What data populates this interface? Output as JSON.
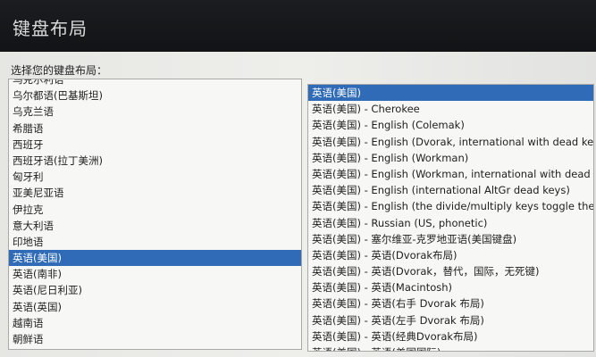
{
  "window": {
    "title": "键盘布局"
  },
  "prompt": "选择您的键盘布局：",
  "left_list": {
    "items": [
      "乌克尔利语",
      "乌尔都语(巴基斯坦)",
      "乌克兰语",
      "希腊语",
      "西班牙",
      "西班牙语(拉丁美洲)",
      "匈牙利",
      "亚美尼亚语",
      "伊拉克",
      "意大利语",
      "印地语",
      "英语(美国)",
      "英语(南非)",
      "英语(尼日利亚)",
      "英语(英国)",
      "越南语",
      "朝鲜语"
    ],
    "selected_index": 11
  },
  "right_list": {
    "items": [
      "英语(美国)",
      "英语(美国) - Cherokee",
      "英语(美国) - English (Colemak)",
      "英语(美国) - English (Dvorak, international with dead keys)",
      "英语(美国) - English (Workman)",
      "英语(美国) - English (Workman, international with dead keys)",
      "英语(美国) - English (international AltGr dead keys)",
      "英语(美国) - English (the divide/multiply keys toggle the layout)",
      "英语(美国) - Russian (US, phonetic)",
      "英语(美国) - 塞尔维亚-克罗地亚语(美国键盘)",
      "英语(美国) - 英语(Dvorak布局)",
      "英语(美国) - 英语(Dvorak，替代，国际，无死键)",
      "英语(美国) - 英语(Macintosh)",
      "英语(美国) - 英语(右手 Dvorak 布局)",
      "英语(美国) - 英语(左手 Dvorak 布局)",
      "英语(美国) - 英语(经典Dvorak布局)",
      "英语(美国) - 英语(美国国际)"
    ],
    "selected_index": 0
  }
}
